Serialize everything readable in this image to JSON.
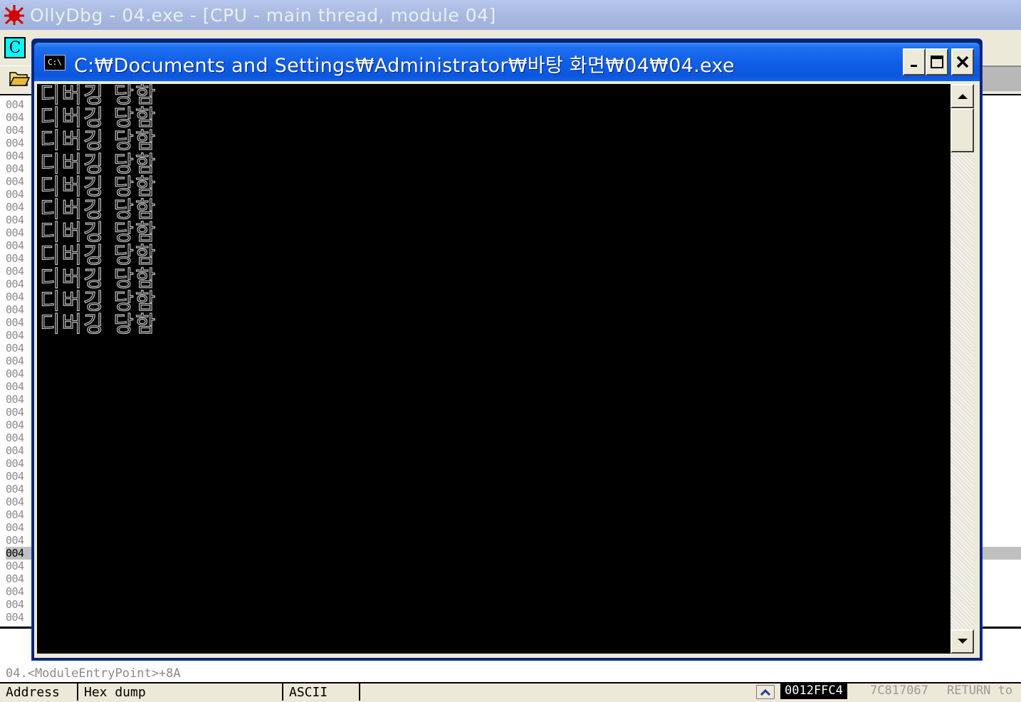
{
  "olly": {
    "window_title": "OllyDbg - 04.exe - [CPU - main thread, module 04]",
    "cpu_icon_label": "C",
    "address_prefix": "004",
    "address_rows": 41,
    "selected_row_index": 35,
    "info_text": "04.<ModuleEntryPoint>+8A",
    "dump_columns": [
      "Address",
      "Hex dump",
      "ASCII"
    ],
    "stack_address": "0012FFC4",
    "stack_value": "7C817067",
    "stack_comment": "RETURN to"
  },
  "console": {
    "title": "C:₩Documents and Settings₩Administrator₩바탕 화면₩04₩04.exe",
    "icon_label": "C:\\",
    "lines": [
      "디버깅 당함",
      "디버깅 당함",
      "디버깅 당함",
      "디버깅 당함",
      "디버깅 당함",
      "디버깅 당함",
      "디버깅 당함",
      "디버깅 당함",
      "디버깅 당함",
      "디버깅 당함",
      "디버깅 당함"
    ],
    "text_color": "#c0c0c0",
    "background_color": "#000000"
  },
  "colors": {
    "xp_blue": "#0b56dd",
    "xp_face": "#ece9d8",
    "olly_inactive_title": "#a8badf"
  }
}
